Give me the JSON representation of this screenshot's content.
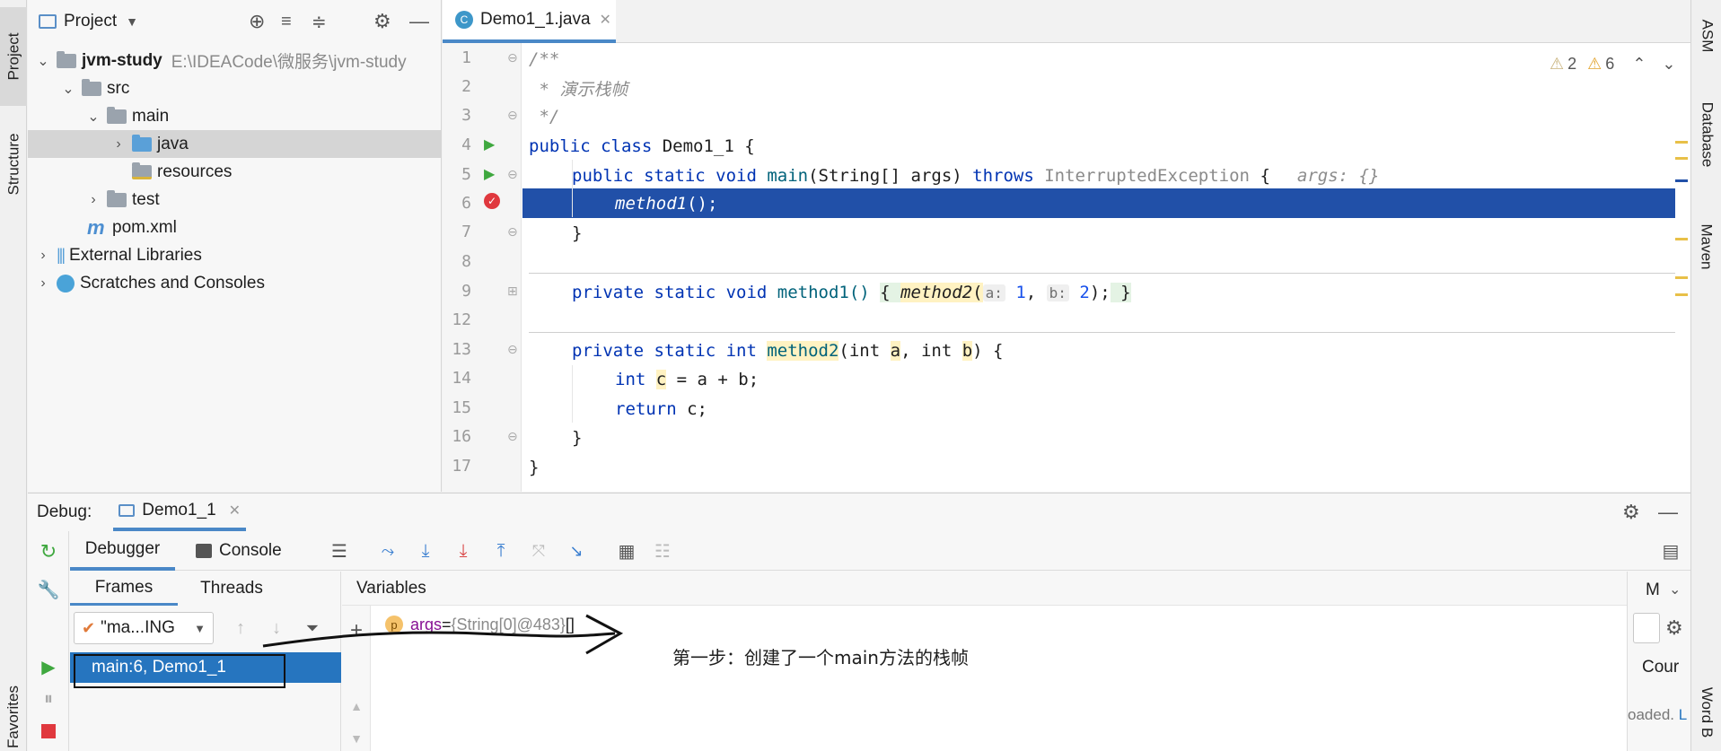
{
  "left_strip": {
    "tabs": [
      "Project",
      "Structure",
      "Favorites"
    ]
  },
  "right_strip": {
    "tabs": [
      "ASM",
      "Database",
      "Maven",
      "Word B"
    ]
  },
  "project": {
    "title": "Project",
    "tree": [
      {
        "label": "jvm-study",
        "path": "E:\\IDEACode\\微服务\\jvm-study",
        "depth": 0,
        "expanded": true
      },
      {
        "label": "src",
        "depth": 1,
        "expanded": true
      },
      {
        "label": "main",
        "depth": 2,
        "expanded": true
      },
      {
        "label": "java",
        "depth": 3,
        "expanded": false,
        "selected": true
      },
      {
        "label": "resources",
        "depth": 3
      },
      {
        "label": "test",
        "depth": 2,
        "expanded": false
      },
      {
        "label": "pom.xml",
        "depth": 1
      },
      {
        "label": "External Libraries",
        "depth": 0,
        "expanded": false
      },
      {
        "label": "Scratches and Consoles",
        "depth": 0,
        "expanded": false
      }
    ]
  },
  "editor": {
    "tab_label": "Demo1_1.java",
    "warnings": {
      "weak_count": "2",
      "warning_count": "6"
    },
    "line_numbers": [
      "1",
      "2",
      "3",
      "4",
      "5",
      "6",
      "7",
      "8",
      "9",
      "12",
      "13",
      "14",
      "15",
      "16",
      "17"
    ],
    "lines": {
      "l1": "/**",
      "l2": " * 演示栈帧",
      "l3": " */",
      "l4_kw": "public class ",
      "l4_name": "Demo1_1 {",
      "l5_kw": "public static void ",
      "l5_name": "main",
      "l5_rest": "(String[] args) ",
      "l5_throws": "throws ",
      "l5_exc": "InterruptedException",
      "l5_brace": " {",
      "l5_hint": "args: {}",
      "l6_call": "method1",
      "l6_rest": "();",
      "l7": "}",
      "l9_kw": "private static void ",
      "l9_name": "method1() ",
      "l9_brace": "{ ",
      "l9_call": "method2",
      "l9_paren": "(",
      "l9_hint_a": "a:",
      "l9_arg1": "1",
      "l9_comma": ", ",
      "l9_hint_b": "b:",
      "l9_arg2": "2",
      "l9_end": ");",
      "l9_close": " }",
      "l13_kw": "private static int ",
      "l13_name": "method2",
      "l13_p1": "(int ",
      "l13_a": "a",
      "l13_p2": ", int ",
      "l13_b": "b",
      "l13_p3": ") {",
      "l14_kw": "int ",
      "l14_c": "c",
      "l14_rest": " = a + b;",
      "l15_kw": "return ",
      "l15_rest": "c;",
      "l16": "}",
      "l17": "}"
    }
  },
  "debug": {
    "label": "Debug:",
    "session_tab": "Demo1_1",
    "tabs": {
      "debugger": "Debugger",
      "console": "Console"
    },
    "subtabs": {
      "frames": "Frames",
      "threads": "Threads"
    },
    "thread_select": "\"ma...ING",
    "frame": "main:6, Demo1_1",
    "variables_title": "Variables",
    "variable": {
      "badge": "p",
      "name": "args",
      "eq": " = ",
      "value": "{String[0]@483}",
      "extra": " []"
    },
    "annotation": "第一步：创建了一个main方法的栈帧",
    "right_partial": {
      "m": "M",
      "cour": "Cour",
      "loaded": "oaded. ",
      "link": "L"
    }
  },
  "colors": {
    "accent": "#4a88c7",
    "exec_line": "#2150a8",
    "frame_selected": "#2675bf",
    "breakpoint": "#e0383e",
    "run_green": "#3fa83f"
  }
}
